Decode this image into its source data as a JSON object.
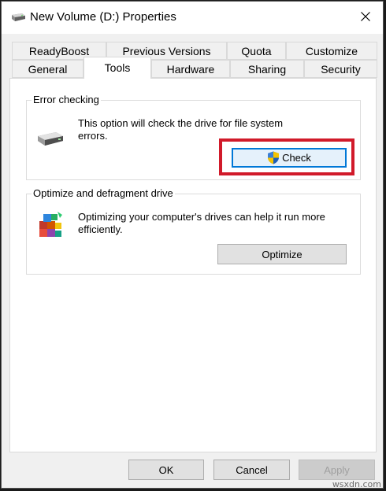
{
  "window": {
    "title": "New Volume (D:) Properties",
    "icon": "drive-icon",
    "close_icon": "close-icon"
  },
  "tabs_row1": [
    "ReadyBoost",
    "Previous Versions",
    "Quota",
    "Customize"
  ],
  "tabs_row2": [
    "General",
    "Tools",
    "Hardware",
    "Sharing",
    "Security"
  ],
  "active_tab": "Tools",
  "error_checking": {
    "title": "Error checking",
    "description": "This option will check the drive for file system errors.",
    "button_label": "Check",
    "button_icon": "uac-shield-icon",
    "icon": "drive-icon"
  },
  "optimize": {
    "title": "Optimize and defragment drive",
    "description": "Optimizing your computer's drives can help it run more efficiently.",
    "button_label": "Optimize",
    "icon": "defrag-icon"
  },
  "footer": {
    "ok_label": "OK",
    "cancel_label": "Cancel",
    "apply_label": "Apply"
  },
  "watermark": "wsxdn.com",
  "colors": {
    "highlight": "#d11a2a",
    "focus": "#0078d7"
  }
}
